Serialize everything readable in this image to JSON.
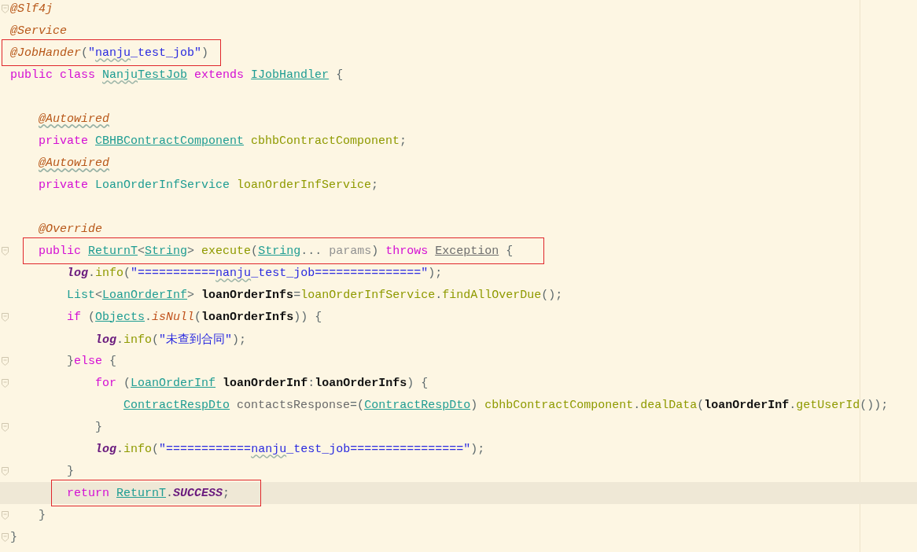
{
  "editor": {
    "lines": [
      {
        "current": false,
        "boxed": false,
        "fold": true,
        "tokens": [
          {
            "text": "@Slf4j",
            "kind": "annotation"
          }
        ]
      },
      {
        "current": false,
        "boxed": false,
        "fold": false,
        "tokens": [
          {
            "text": "@Service",
            "kind": "annotation"
          }
        ]
      },
      {
        "current": false,
        "boxed": true,
        "fold": false,
        "tokens": [
          {
            "text": "@JobHander",
            "kind": "annotation"
          },
          {
            "text": "(",
            "kind": "plain"
          },
          {
            "text": "\"",
            "kind": "string"
          },
          {
            "text": "nanju",
            "kind": "string",
            "squiggle": true
          },
          {
            "text": "_test_job\"",
            "kind": "string"
          },
          {
            "text": ")",
            "kind": "plain"
          }
        ]
      },
      {
        "current": false,
        "boxed": false,
        "fold": false,
        "tokens": [
          {
            "text": "public class ",
            "kind": "keyword"
          },
          {
            "text": "Nanju",
            "kind": "class",
            "squiggle": true
          },
          {
            "text": "TestJob",
            "kind": "class-link"
          },
          {
            "text": " extends ",
            "kind": "keyword"
          },
          {
            "text": "IJobHandler",
            "kind": "class-link"
          },
          {
            "text": " {",
            "kind": "plain"
          }
        ]
      },
      {
        "current": false,
        "boxed": false,
        "fold": false
      },
      {
        "current": false,
        "boxed": false,
        "fold": false,
        "tokens": [
          {
            "text": "    @Autowired",
            "kind": "annotation",
            "squiggle": true
          }
        ]
      },
      {
        "current": false,
        "boxed": false,
        "fold": false,
        "tokens": [
          {
            "text": "    private ",
            "kind": "keyword"
          },
          {
            "text": "CBHBContractComponent",
            "kind": "class-link"
          },
          {
            "text": " cbhbContractComponent",
            "kind": "field"
          },
          {
            "text": ";",
            "kind": "plain"
          }
        ]
      },
      {
        "current": false,
        "boxed": false,
        "fold": false,
        "tokens": [
          {
            "text": "    @Autowired",
            "kind": "annotation",
            "squiggle": true
          }
        ]
      },
      {
        "current": false,
        "boxed": false,
        "fold": false,
        "tokens": [
          {
            "text": "    private ",
            "kind": "keyword"
          },
          {
            "text": "LoanOrderInfService",
            "kind": "class"
          },
          {
            "text": " loanOrderInfService",
            "kind": "field"
          },
          {
            "text": ";",
            "kind": "plain"
          }
        ]
      },
      {
        "current": false,
        "boxed": false,
        "fold": false
      },
      {
        "current": false,
        "boxed": false,
        "fold": false,
        "tokens": [
          {
            "text": "    @Override",
            "kind": "annotation"
          }
        ]
      },
      {
        "current": false,
        "boxed": true,
        "fold": true,
        "tokens": [
          {
            "text": "    public ",
            "kind": "keyword"
          },
          {
            "text": "ReturnT",
            "kind": "class-link"
          },
          {
            "text": "<",
            "kind": "plain"
          },
          {
            "text": "String",
            "kind": "class-link"
          },
          {
            "text": "> ",
            "kind": "plain"
          },
          {
            "text": "execute",
            "kind": "method"
          },
          {
            "text": "(",
            "kind": "plain"
          },
          {
            "text": "String",
            "kind": "class-link"
          },
          {
            "text": "... ",
            "kind": "plain"
          },
          {
            "text": "params",
            "kind": "param"
          },
          {
            "text": ") ",
            "kind": "plain"
          },
          {
            "text": "throws ",
            "kind": "keyword"
          },
          {
            "text": "Exception",
            "kind": "grey-link"
          },
          {
            "text": " {",
            "kind": "plain"
          }
        ]
      },
      {
        "current": false,
        "boxed": false,
        "fold": false,
        "tokens": [
          {
            "text": "        log",
            "kind": "static-field"
          },
          {
            "text": ".",
            "kind": "plain"
          },
          {
            "text": "info",
            "kind": "method"
          },
          {
            "text": "(",
            "kind": "plain"
          },
          {
            "text": "\"===========",
            "kind": "string"
          },
          {
            "text": "nanju",
            "kind": "string",
            "squiggle": true
          },
          {
            "text": "_test_job===============\"",
            "kind": "string"
          },
          {
            "text": ");",
            "kind": "plain"
          }
        ]
      },
      {
        "current": false,
        "boxed": false,
        "fold": false,
        "tokens": [
          {
            "text": "        List",
            "kind": "class"
          },
          {
            "text": "<",
            "kind": "plain"
          },
          {
            "text": "LoanOrderInf",
            "kind": "class-link"
          },
          {
            "text": "> ",
            "kind": "plain"
          },
          {
            "text": "loanOrderInfs",
            "kind": "local"
          },
          {
            "text": "=",
            "kind": "plain"
          },
          {
            "text": "loanOrderInfService",
            "kind": "field"
          },
          {
            "text": ".",
            "kind": "plain"
          },
          {
            "text": "findAllOverDue",
            "kind": "method"
          },
          {
            "text": "();",
            "kind": "plain"
          }
        ]
      },
      {
        "current": false,
        "boxed": false,
        "fold": true,
        "tokens": [
          {
            "text": "        if ",
            "kind": "keyword"
          },
          {
            "text": "(",
            "kind": "plain"
          },
          {
            "text": "Objects",
            "kind": "class-link"
          },
          {
            "text": ".",
            "kind": "plain"
          },
          {
            "text": "isNull",
            "kind": "static-method"
          },
          {
            "text": "(",
            "kind": "plain"
          },
          {
            "text": "loanOrderInfs",
            "kind": "local"
          },
          {
            "text": ")) {",
            "kind": "plain"
          }
        ]
      },
      {
        "current": false,
        "boxed": false,
        "fold": false,
        "tokens": [
          {
            "text": "            log",
            "kind": "static-field"
          },
          {
            "text": ".",
            "kind": "plain"
          },
          {
            "text": "info",
            "kind": "method"
          },
          {
            "text": "(",
            "kind": "plain"
          },
          {
            "text": "\"未查到合同\"",
            "kind": "string"
          },
          {
            "text": ");",
            "kind": "plain"
          }
        ]
      },
      {
        "current": false,
        "boxed": false,
        "fold": true,
        "tokens": [
          {
            "text": "        }",
            "kind": "plain"
          },
          {
            "text": "else",
            "kind": "keyword"
          },
          {
            "text": " {",
            "kind": "plain"
          }
        ]
      },
      {
        "current": false,
        "boxed": false,
        "fold": true,
        "tokens": [
          {
            "text": "            for ",
            "kind": "keyword"
          },
          {
            "text": "(",
            "kind": "plain"
          },
          {
            "text": "LoanOrderInf",
            "kind": "class-link"
          },
          {
            "text": " loanOrderInf",
            "kind": "local"
          },
          {
            "text": ":",
            "kind": "plain"
          },
          {
            "text": "loanOrderInfs",
            "kind": "local"
          },
          {
            "text": ") {",
            "kind": "plain"
          }
        ]
      },
      {
        "current": false,
        "boxed": false,
        "fold": false,
        "tokens": [
          {
            "text": "                ContractRespDto",
            "kind": "class-link"
          },
          {
            "text": " contactsResponse",
            "kind": "unused"
          },
          {
            "text": "=(",
            "kind": "plain"
          },
          {
            "text": "ContractRespDto",
            "kind": "class-link"
          },
          {
            "text": ") ",
            "kind": "plain"
          },
          {
            "text": "cbhbContractComponent",
            "kind": "field"
          },
          {
            "text": ".",
            "kind": "plain"
          },
          {
            "text": "dealData",
            "kind": "method"
          },
          {
            "text": "(",
            "kind": "plain"
          },
          {
            "text": "loanOrderInf",
            "kind": "local"
          },
          {
            "text": ".",
            "kind": "plain"
          },
          {
            "text": "getUserId",
            "kind": "method"
          },
          {
            "text": "());",
            "kind": "plain"
          }
        ]
      },
      {
        "current": false,
        "boxed": false,
        "fold": true,
        "tokens": [
          {
            "text": "            }",
            "kind": "plain"
          }
        ]
      },
      {
        "current": false,
        "boxed": false,
        "fold": false,
        "tokens": [
          {
            "text": "            log",
            "kind": "static-field"
          },
          {
            "text": ".",
            "kind": "plain"
          },
          {
            "text": "info",
            "kind": "method"
          },
          {
            "text": "(",
            "kind": "plain"
          },
          {
            "text": "\"============",
            "kind": "string"
          },
          {
            "text": "nanju",
            "kind": "string",
            "squiggle": true
          },
          {
            "text": "_test_job================\"",
            "kind": "string"
          },
          {
            "text": ");",
            "kind": "plain"
          }
        ]
      },
      {
        "current": false,
        "boxed": false,
        "fold": true,
        "tokens": [
          {
            "text": "        }",
            "kind": "plain"
          }
        ]
      },
      {
        "current": true,
        "boxed": true,
        "fold": false,
        "tokens": [
          {
            "text": "        return ",
            "kind": "keyword"
          },
          {
            "text": "ReturnT",
            "kind": "class-link"
          },
          {
            "text": ".",
            "kind": "plain"
          },
          {
            "text": "SUCCESS",
            "kind": "constant"
          },
          {
            "text": ";",
            "kind": "plain"
          }
        ]
      },
      {
        "current": false,
        "boxed": false,
        "fold": true,
        "tokens": [
          {
            "text": "    }",
            "kind": "plain"
          }
        ]
      },
      {
        "current": false,
        "boxed": false,
        "fold": true,
        "tokens": [
          {
            "text": "}",
            "kind": "plain"
          }
        ]
      }
    ]
  }
}
